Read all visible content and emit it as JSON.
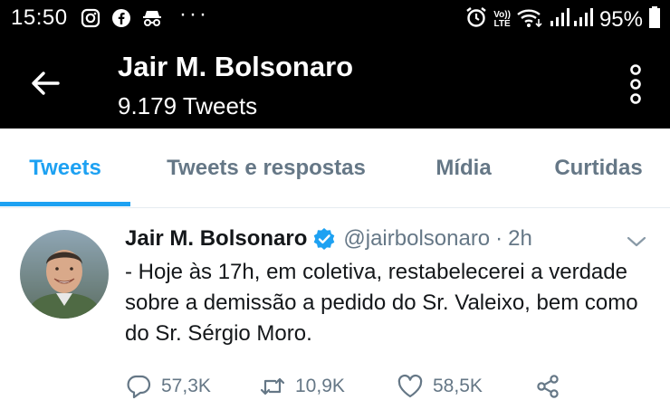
{
  "status_bar": {
    "time": "15:50",
    "dots": "···",
    "battery": "95%",
    "lte_top": "Vo))",
    "lte_bottom": "LTE",
    "icons": [
      "instagram-icon",
      "facebook-icon",
      "incognito-icon",
      "alarm-icon",
      "wifi-icon",
      "signal-icon",
      "battery-icon"
    ]
  },
  "header": {
    "title": "Jair M. Bolsonaro",
    "subtitle": "9.179 Tweets"
  },
  "tabs": [
    {
      "label": "Tweets",
      "active": true
    },
    {
      "label": "Tweets e respostas",
      "active": false
    },
    {
      "label": "Mídia",
      "active": false
    },
    {
      "label": "Curtidas",
      "active": false
    }
  ],
  "tweet": {
    "name": "Jair M. Bolsonaro",
    "handle": "@jairbolsonaro",
    "separator": "·",
    "time": "2h",
    "text": "- Hoje às 17h, em coletiva, restabelecerei a verdade sobre a demissão a pedido do Sr. Valeixo, bem como do Sr. Sérgio Moro.",
    "replies": "57,3K",
    "retweets": "10,9K",
    "likes": "58,5K"
  },
  "colors": {
    "accent": "#1da1f2",
    "header_bg": "#000000",
    "muted": "#657786"
  }
}
